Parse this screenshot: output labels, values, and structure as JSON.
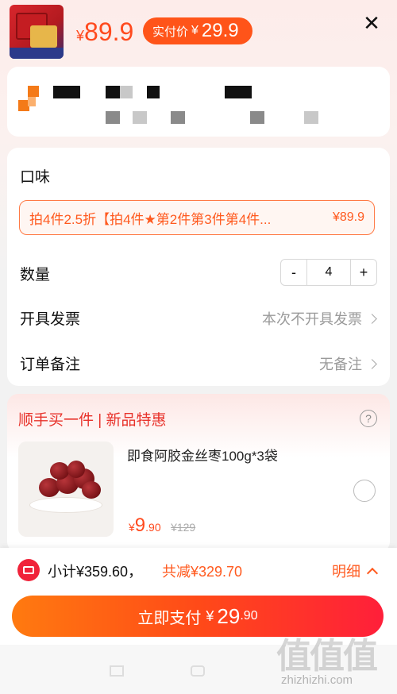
{
  "header": {
    "price_symbol": "¥",
    "price": "89.9",
    "actual_label": "实付价",
    "actual_symbol": "¥",
    "actual_price": "29.9",
    "close_glyph": "✕"
  },
  "options": {
    "flavor_label": "口味",
    "variant_text": "拍4件2.5折【拍4件★第2件第3件第4件...",
    "variant_price": "¥89.9",
    "quantity_label": "数量",
    "qty_minus": "-",
    "qty_value": "4",
    "qty_plus": "+",
    "invoice_label": "开具发票",
    "invoice_value": "本次不开具发票",
    "note_label": "订单备注",
    "note_value": "无备注"
  },
  "recommend": {
    "title": "顺手买一件 | 新品特惠",
    "help_glyph": "?",
    "product_name": "即食阿胶金丝枣100g*3袋",
    "price_symbol": "¥",
    "price_int": "9",
    "price_dec": ".90",
    "orig_price": "¥129"
  },
  "footer": {
    "subtotal": "小计¥359.60，",
    "discount": "共减¥329.70",
    "detail_label": "明细",
    "pay_label": "立即支付",
    "pay_symbol": "¥",
    "pay_int": "29",
    "pay_dec": ".90"
  },
  "watermark": {
    "chars": "值值值",
    "url": "zhizhizhi.com"
  },
  "colors": {
    "accent": "#ff5419",
    "pay_gradient_start": "#ff7a10",
    "pay_gradient_end": "#ff1f3a",
    "rec_title": "#e8322b"
  }
}
